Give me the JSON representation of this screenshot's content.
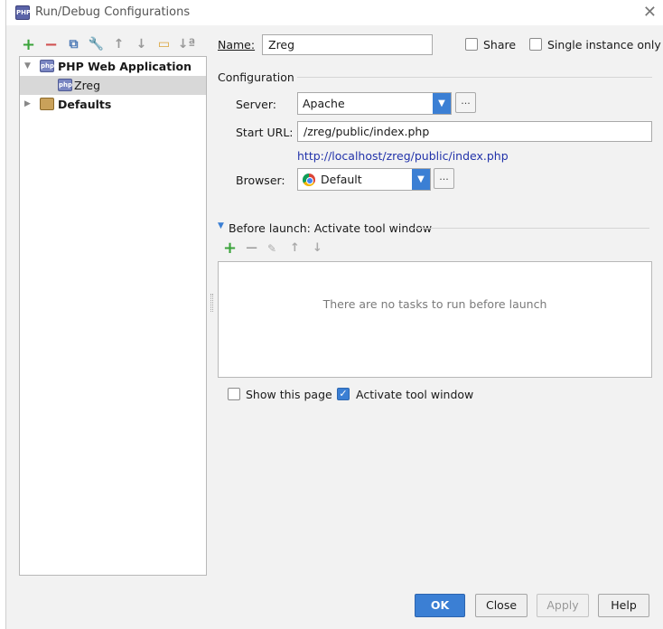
{
  "window": {
    "title": "Run/Debug Configurations",
    "icon_text": "PHP"
  },
  "toolbar": {
    "add": "+",
    "remove": "−",
    "copy": "⧉",
    "edit_defaults": "🔧",
    "move_up": "↑",
    "move_down": "↓",
    "folder": "▭",
    "sort": "↓ª"
  },
  "tree": {
    "items": [
      {
        "label": "PHP Web Application",
        "icon_text": "php",
        "expanded": true
      },
      {
        "label": "Zreg",
        "icon_text": "php",
        "selected": true
      },
      {
        "label": "Defaults",
        "icon_text": "",
        "expanded": false
      }
    ]
  },
  "form": {
    "name_label": "Name:",
    "name_value": "Zreg",
    "share_label": "Share",
    "single_instance_label": "Single instance only",
    "configuration_heading": "Configuration",
    "server_label": "Server:",
    "server_value": "Apache",
    "start_url_label": "Start URL:",
    "start_url_value": "/zreg/public/index.php",
    "resolved_url": "http://localhost/zreg/public/index.php",
    "browser_label": "Browser:",
    "browser_value": "Default",
    "ellipsis": "..."
  },
  "before_launch": {
    "heading": "Before launch: Activate tool window",
    "empty_text": "There are no tasks to run before launch",
    "show_page_label": "Show this page",
    "activate_tool_window_label": "Activate tool window",
    "activate_checked": true,
    "show_page_checked": false
  },
  "buttons": {
    "ok": "OK",
    "close": "Close",
    "apply": "Apply",
    "help": "Help"
  }
}
